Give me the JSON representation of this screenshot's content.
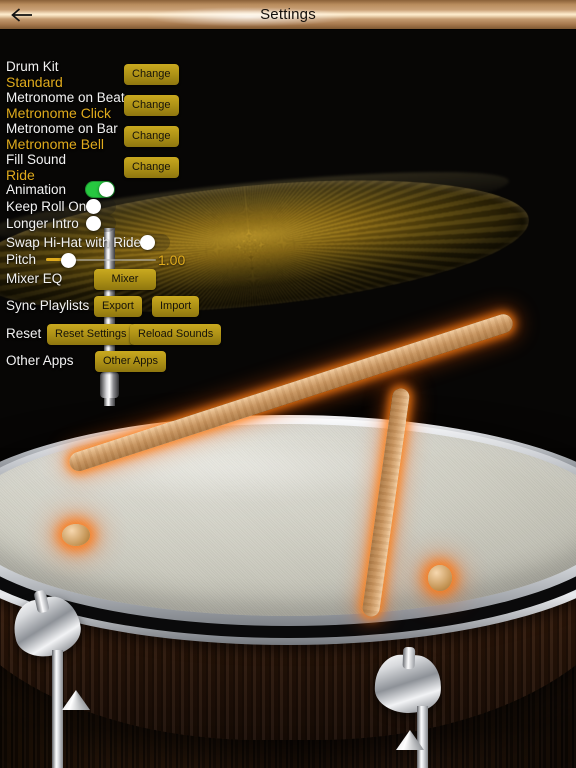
{
  "header": {
    "title": "Settings",
    "back_icon": "arrow-left-icon"
  },
  "settings": {
    "rows": [
      {
        "label": "Drum Kit",
        "value": "Standard",
        "button": "Change"
      },
      {
        "label": "Metronome on Beat",
        "value": "Metronome Click",
        "button": "Change"
      },
      {
        "label": "Metronome on Bar",
        "value": "Metronome Bell",
        "button": "Change"
      },
      {
        "label": "Fill Sound",
        "value": "Ride",
        "button": "Change"
      }
    ],
    "toggles": [
      {
        "label": "Animation",
        "state": "on"
      },
      {
        "label": "Keep Roll On",
        "state": "off"
      },
      {
        "label": "Longer Intro",
        "state": "off"
      },
      {
        "label": "Swap Hi-Hat with Ride",
        "state": "off"
      }
    ],
    "pitch": {
      "label": "Pitch",
      "value": "1.00",
      "percent": 14
    },
    "mixer": {
      "label": "Mixer EQ",
      "button": "Mixer"
    },
    "sync": {
      "label": "Sync Playlists",
      "export_button": "Export",
      "import_button": "Import"
    },
    "reset": {
      "label": "Reset",
      "reset_button": "Reset Settings",
      "reload_button": "Reload Sounds"
    },
    "other": {
      "label": "Other Apps",
      "button": "Other Apps"
    }
  },
  "colors": {
    "accent_gold": "#e0ab1d",
    "button_gold": "#ab8f15",
    "toggle_on_green": "#27c840",
    "label_white": "#f2f2f2",
    "header_brass": "#caa178",
    "stick_glow_orange": "#ff7f14",
    "drumhead": "#cfcec3",
    "wood_shell": "#4a2a12"
  },
  "scene": {
    "objects": [
      "ride-cymbal",
      "cymbal-stand",
      "snare-drum",
      "drumstick-left",
      "drumstick-right",
      "wood-floor"
    ]
  }
}
